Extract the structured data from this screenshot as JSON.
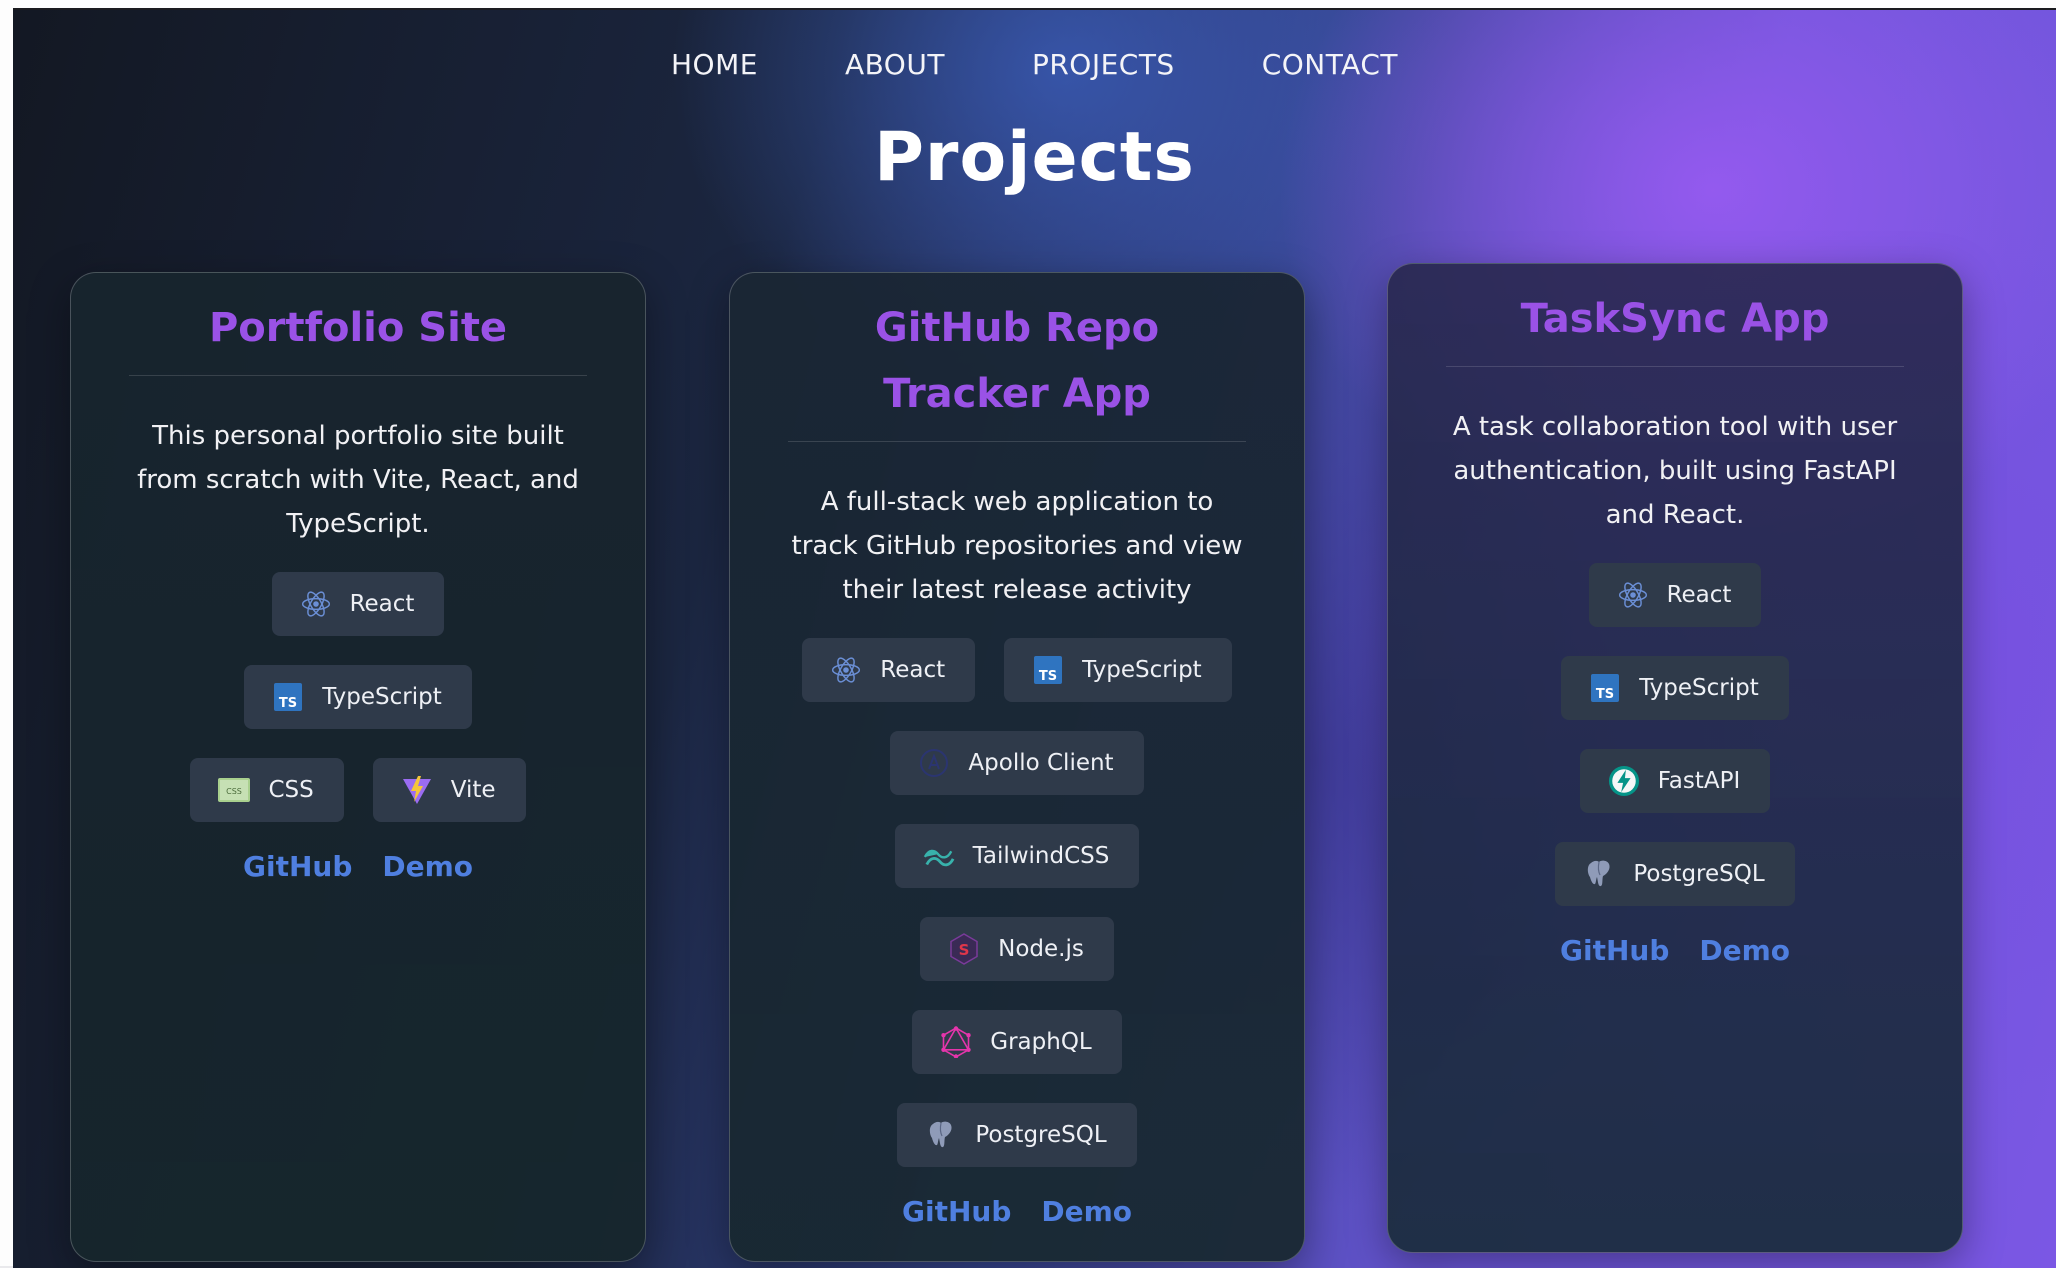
{
  "nav": {
    "items": [
      {
        "label": "HOME"
      },
      {
        "label": "ABOUT"
      },
      {
        "label": "PROJECTS"
      },
      {
        "label": "CONTACT"
      }
    ]
  },
  "page_title": "Projects",
  "colors": {
    "accent_purple": "#9a52e6",
    "link_blue": "#4f7fe0",
    "tag_bg": "#2f3a4a"
  },
  "projects": [
    {
      "title": "Portfolio Site",
      "description": "This personal portfolio site built from scratch with Vite, React, and TypeScript.",
      "tags": [
        {
          "label": "React",
          "icon": "react-icon"
        },
        {
          "label": "TypeScript",
          "icon": "typescript-icon"
        },
        {
          "label": "CSS",
          "icon": "css-icon"
        },
        {
          "label": "Vite",
          "icon": "vite-icon"
        }
      ],
      "links": {
        "github": "GitHub",
        "demo": "Demo"
      }
    },
    {
      "title": "GitHub Repo Tracker App",
      "description": "A full-stack web application to track GitHub repositories and view their latest release activity",
      "tags": [
        {
          "label": "React",
          "icon": "react-icon"
        },
        {
          "label": "TypeScript",
          "icon": "typescript-icon"
        },
        {
          "label": "Apollo Client",
          "icon": "apollo-icon"
        },
        {
          "label": "TailwindCSS",
          "icon": "tailwind-icon"
        },
        {
          "label": "Node.js",
          "icon": "nodejs-icon"
        },
        {
          "label": "GraphQL",
          "icon": "graphql-icon"
        },
        {
          "label": "PostgreSQL",
          "icon": "postgresql-icon"
        }
      ],
      "links": {
        "github": "GitHub",
        "demo": "Demo"
      }
    },
    {
      "title": "TaskSync App",
      "description": "A task collaboration tool with user authentication, built using FastAPI and React.",
      "tags": [
        {
          "label": "React",
          "icon": "react-icon"
        },
        {
          "label": "TypeScript",
          "icon": "typescript-icon"
        },
        {
          "label": "FastAPI",
          "icon": "fastapi-icon"
        },
        {
          "label": "PostgreSQL",
          "icon": "postgresql-icon"
        }
      ],
      "links": {
        "github": "GitHub",
        "demo": "Demo"
      }
    }
  ]
}
